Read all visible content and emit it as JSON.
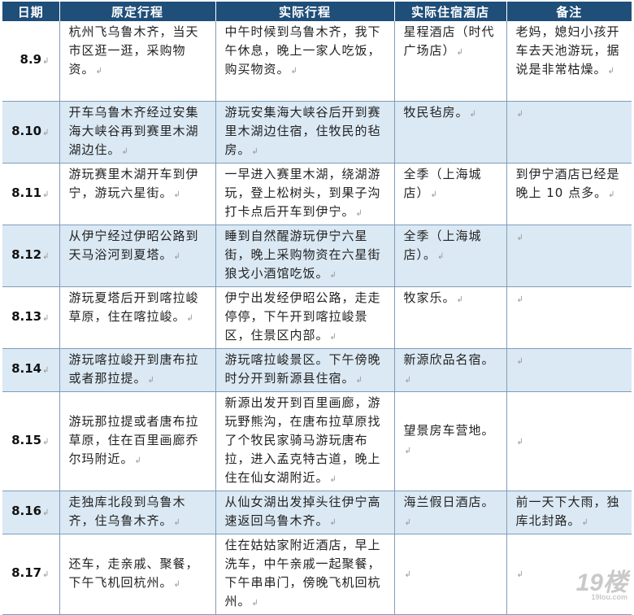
{
  "headers": [
    "日期",
    "原定行程",
    "实际行程",
    "实际住宿酒店",
    "备注"
  ],
  "para_mark": "↲",
  "rows": [
    {
      "date": "8.9",
      "plan": "杭州飞乌鲁木齐，当天市区逛一逛，采购物资。",
      "actual": "中午时候到乌鲁木齐，我下午休息，晚上一家人吃饭，购买物资。",
      "hotel": "星程酒店（时代广场店）",
      "note": "老妈，媳妇小孩开车去天池游玩，据说是非常枯燥。"
    },
    {
      "date": "8.10",
      "plan": "开车乌鲁木齐经过安集海大峡谷再到赛里木湖湖边住。",
      "actual": "游玩安集海大峡谷后开到赛里木湖边住宿，住牧民的毡房。",
      "hotel": "牧民毡房。",
      "note": ""
    },
    {
      "date": "8.11",
      "plan": "游玩赛里木湖开车到伊宁，游玩六星街。",
      "actual": "一早进入赛里木湖，绕湖游玩，登上松树头，到果子沟打卡点后开车到伊宁。",
      "hotel": "全季（上海城店）",
      "note": "到伊宁酒店已经是晚上 10 点多。"
    },
    {
      "date": "8.12",
      "plan": "从伊宁经过伊昭公路到天马浴河到夏塔。",
      "actual": "睡到自然醒游玩伊宁六星街，晚上采购物资在六星街狼戈小酒馆吃饭。",
      "hotel": "全季（上海城店）。",
      "note": ""
    },
    {
      "date": "8.13",
      "plan": "游玩夏塔后开到喀拉峻草原，住在喀拉峻。",
      "actual": "伊宁出发经伊昭公路，走走停停，下午开到喀拉峻景区，住景区内部。",
      "hotel": "牧家乐。",
      "note": ""
    },
    {
      "date": "8.14",
      "plan": "游玩喀拉峻开到唐布拉或者那拉提。",
      "actual": "游玩喀拉峻景区。下午傍晚时分开到新源县住宿。",
      "hotel": "新源欣品名宿。",
      "note": ""
    },
    {
      "date": "8.15",
      "plan": "游玩那拉提或者唐布拉草原，住在百里画廊乔尔玛附近。",
      "actual": "新源出发开到百里画廊，游玩野熊沟，在唐布拉草原找了个牧民家骑马游玩唐布拉，进入孟克特古道，晚上住在仙女湖附近。",
      "hotel": "望景房车营地。",
      "note": ""
    },
    {
      "date": "8.16",
      "plan": "走独库北段到乌鲁木齐，住乌鲁木齐。",
      "actual": "从仙女湖出发掉头往伊宁高速返回乌鲁木齐。",
      "hotel": "海兰假日酒店。",
      "note": "前一天下大雨，独库北封路。"
    },
    {
      "date": "8.17",
      "plan": "还车，走亲戚、聚餐，下午飞机回杭州。",
      "actual": "住在姑姑家附近酒店，早上洗车，中午亲戚一起聚餐，下午串串门，傍晚飞机回杭州。",
      "hotel": "",
      "note": ""
    }
  ],
  "watermark": {
    "main": "19楼",
    "sub": "19lou.com"
  }
}
